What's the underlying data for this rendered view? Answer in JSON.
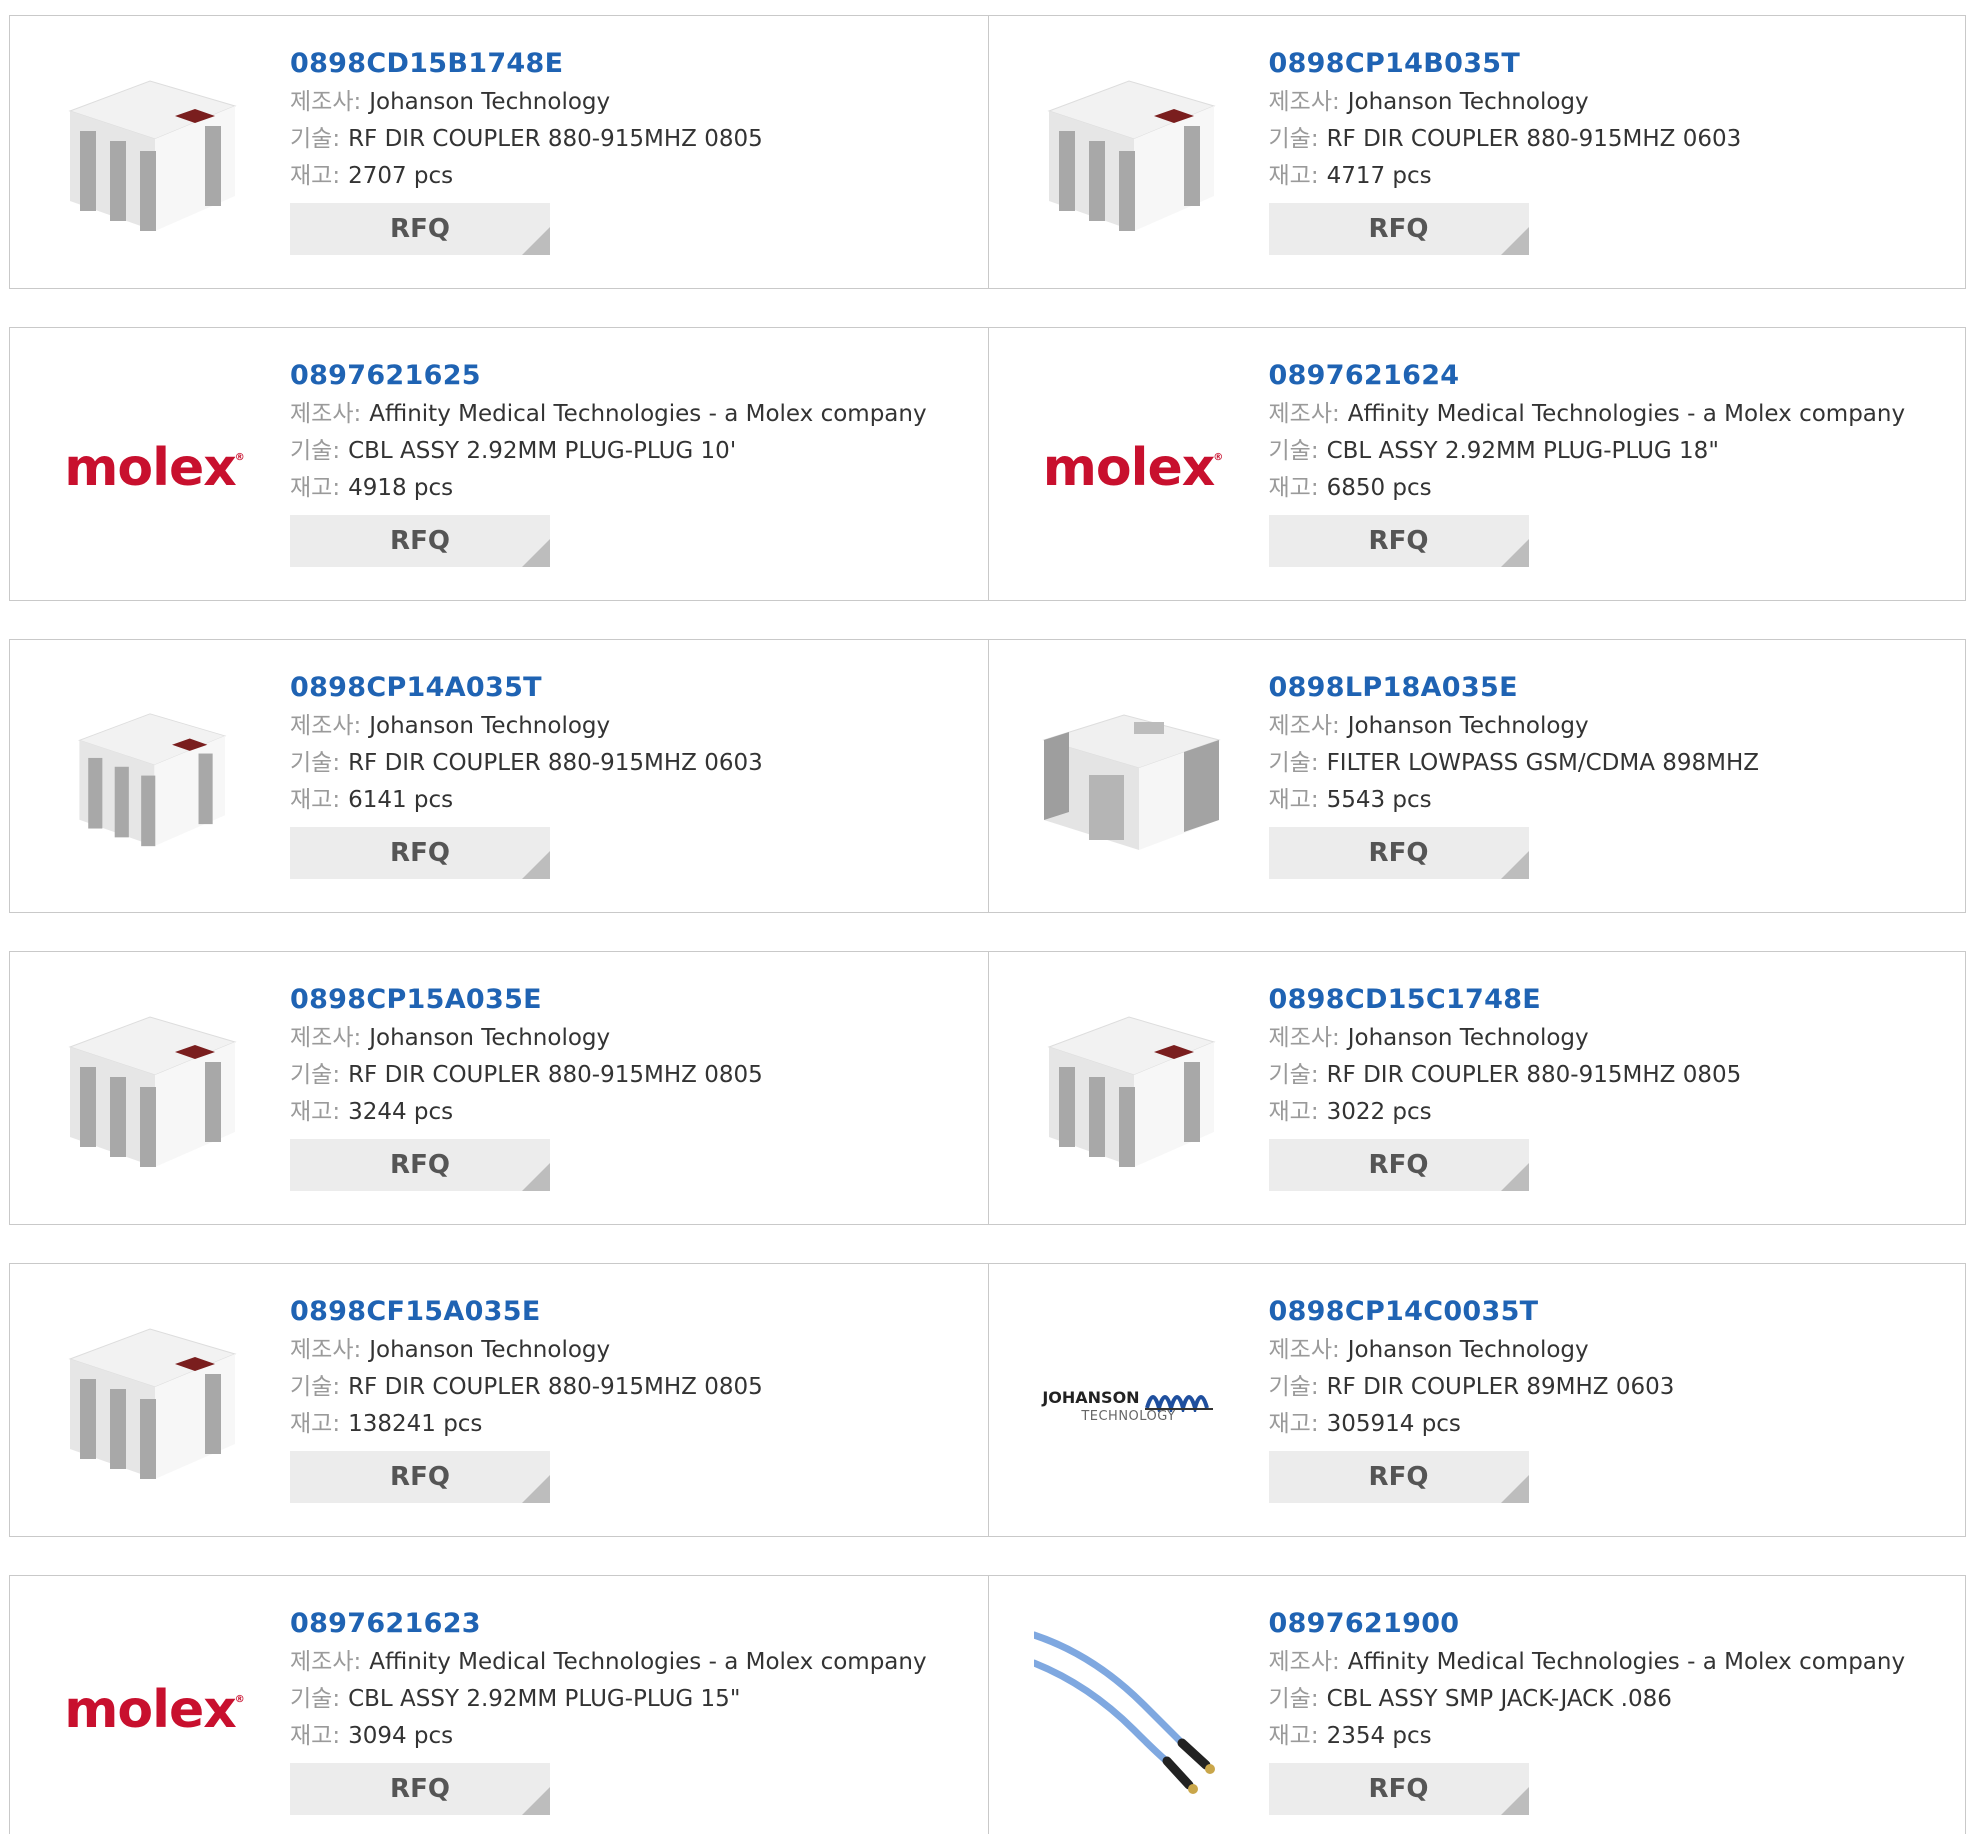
{
  "labels": {
    "manufacturer": "제조사:",
    "description": "기술:",
    "stock": "재고:",
    "rfq": "RFQ"
  },
  "products": [
    {
      "part": "0898CD15B1748E",
      "manufacturer": "Johanson Technology",
      "description": "RF DIR COUPLER 880-915MHZ 0805",
      "stock": "2707 pcs",
      "image": "coupler-chip-icon"
    },
    {
      "part": "0898CP14B035T",
      "manufacturer": "Johanson Technology",
      "description": "RF DIR COUPLER 880-915MHZ 0603",
      "stock": "4717 pcs",
      "image": "coupler-chip-icon"
    },
    {
      "part": "0897621625",
      "manufacturer": "Affinity Medical Technologies - a Molex company",
      "description": "CBL ASSY 2.92MM PLUG-PLUG 10'",
      "stock": "4918 pcs",
      "image": "molex-logo",
      "logo_text": "molex"
    },
    {
      "part": "0897621624",
      "manufacturer": "Affinity Medical Technologies - a Molex company",
      "description": "CBL ASSY 2.92MM PLUG-PLUG 18\"",
      "stock": "6850 pcs",
      "image": "molex-logo",
      "logo_text": "molex"
    },
    {
      "part": "0898CP14A035T",
      "manufacturer": "Johanson Technology",
      "description": "RF DIR COUPLER 880-915MHZ 0603",
      "stock": "6141 pcs",
      "image": "coupler-chip-icon"
    },
    {
      "part": "0898LP18A035E",
      "manufacturer": "Johanson Technology",
      "description": "FILTER LOWPASS GSM/CDMA 898MHZ",
      "stock": "5543 pcs",
      "image": "filter-chip-icon"
    },
    {
      "part": "0898CP15A035E",
      "manufacturer": "Johanson Technology",
      "description": "RF DIR COUPLER 880-915MHZ 0805",
      "stock": "3244 pcs",
      "image": "coupler-chip-icon"
    },
    {
      "part": "0898CD15C1748E",
      "manufacturer": "Johanson Technology",
      "description": "RF DIR COUPLER 880-915MHZ 0805",
      "stock": "3022 pcs",
      "image": "coupler-chip-icon"
    },
    {
      "part": "0898CF15A035E",
      "manufacturer": "Johanson Technology",
      "description": "RF DIR COUPLER 880-915MHZ 0805",
      "stock": "138241 pcs",
      "image": "coupler-chip-icon"
    },
    {
      "part": "0898CP14C0035T",
      "manufacturer": "Johanson Technology",
      "description": "RF DIR COUPLER 89MHZ 0603",
      "stock": "305914 pcs",
      "image": "johanson-logo",
      "logo_text": "JOHANSON",
      "logo_sub": "TECHNOLOGY"
    },
    {
      "part": "0897621623",
      "manufacturer": "Affinity Medical Technologies - a Molex company",
      "description": "CBL ASSY 2.92MM PLUG-PLUG 15\"",
      "stock": "3094 pcs",
      "image": "molex-logo",
      "logo_text": "molex"
    },
    {
      "part": "0897621900",
      "manufacturer": "Affinity Medical Technologies - a Molex company",
      "description": "CBL ASSY SMP JACK-JACK .086",
      "stock": "2354 pcs",
      "image": "cable-icon"
    }
  ]
}
